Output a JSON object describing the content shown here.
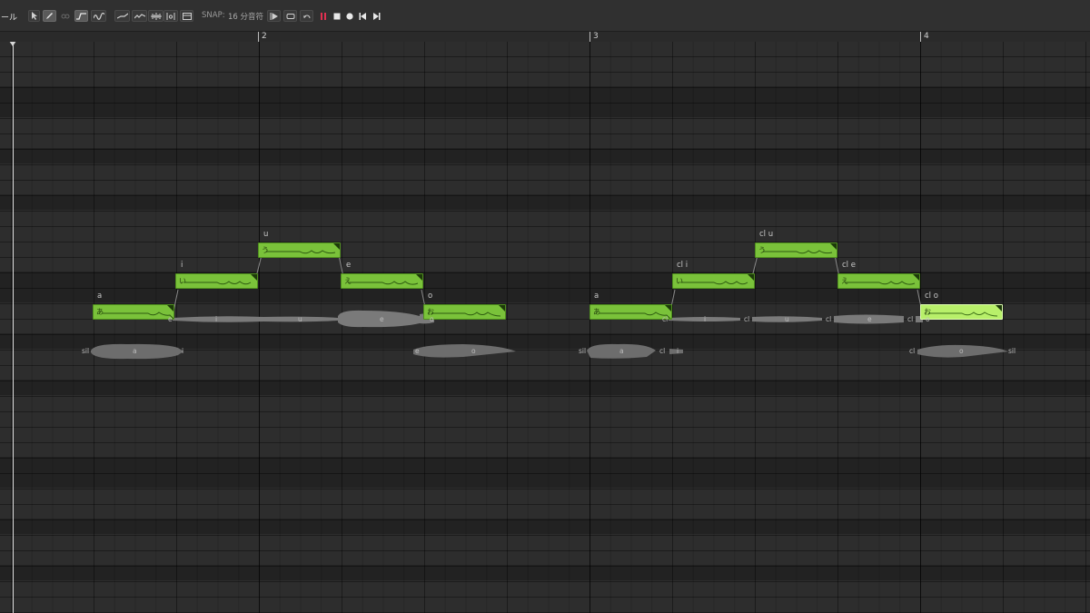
{
  "app": {
    "title_fragment": "ール"
  },
  "toolbar": {
    "snap_label": "SNAP:",
    "snap_value": "16 分音符",
    "record_color": "#e03050",
    "tools": [
      {
        "name": "select-tool",
        "icon": "cursor-icon"
      },
      {
        "name": "pencil-tool",
        "icon": "pencil-icon"
      },
      {
        "name": "link-tool",
        "icon": "link-icon"
      },
      {
        "name": "pitch-tool",
        "icon": "pitch-curve-icon"
      },
      {
        "name": "vibrato-tool",
        "icon": "vibrato-icon"
      }
    ]
  },
  "ruler": {
    "bars": [
      "2",
      "3",
      "4"
    ]
  },
  "notes": [
    {
      "phoneme": "a",
      "lyric": "あ",
      "selected": false
    },
    {
      "phoneme": "i",
      "lyric": "い",
      "selected": false
    },
    {
      "phoneme": "u",
      "lyric": "う",
      "selected": false
    },
    {
      "phoneme": "e",
      "lyric": "え",
      "selected": false
    },
    {
      "phoneme": "o",
      "lyric": "お",
      "selected": false
    },
    {
      "phoneme": "a",
      "lyric": "あ",
      "selected": false
    },
    {
      "phoneme": "cl i",
      "lyric": "い",
      "selected": false
    },
    {
      "phoneme": "cl u",
      "lyric": "う",
      "selected": false
    },
    {
      "phoneme": "cl e",
      "lyric": "え",
      "selected": false
    },
    {
      "phoneme": "cl o",
      "lyric": "お",
      "selected": true
    }
  ],
  "wave_labels_top": [
    "e",
    "i",
    "u",
    "e",
    "o",
    "cl",
    "i",
    "cl",
    "u",
    "cl",
    "e",
    "cl",
    "o"
  ],
  "wave_labels_bottom": [
    "sil",
    "a",
    "i",
    "e",
    "o",
    "sil",
    "a",
    "cl",
    "i",
    "cl",
    "o",
    "sil"
  ],
  "colors": {
    "note": "#7ac23a",
    "note_selected": "#b8f06a",
    "background": "#262626"
  }
}
